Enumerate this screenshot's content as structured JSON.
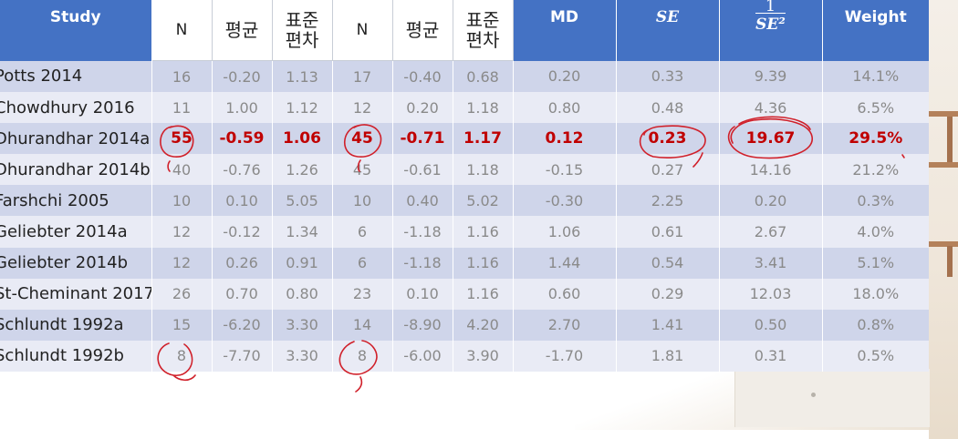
{
  "header": {
    "study": "Study",
    "n1": "N",
    "mean1": "평균",
    "sd1_line1": "표준",
    "sd1_line2": "편차",
    "n2": "N",
    "mean2": "평균",
    "sd2_line1": "표준",
    "sd2_line2": "편차",
    "md": "MD",
    "se": "SE",
    "inv_num": "1",
    "inv_den": "SE²",
    "weight": "Weight"
  },
  "rows": [
    {
      "study": "Potts 2014",
      "n1": "16",
      "m1": "-0.20",
      "sd1": "1.13",
      "n2": "17",
      "m2": "-0.40",
      "sd2": "0.68",
      "md": "0.20",
      "se": "0.33",
      "inv": "9.39",
      "w": "14.1%"
    },
    {
      "study": "Chowdhury 2016",
      "n1": "11",
      "m1": "1.00",
      "sd1": "1.12",
      "n2": "12",
      "m2": "0.20",
      "sd2": "1.18",
      "md": "0.80",
      "se": "0.48",
      "inv": "4.36",
      "w": "6.5%"
    },
    {
      "study": "Dhurandhar 2014a",
      "n1": "55",
      "m1": "-0.59",
      "sd1": "1.06",
      "n2": "45",
      "m2": "-0.71",
      "sd2": "1.17",
      "md": "0.12",
      "se": "0.23",
      "inv": "19.67",
      "w": "29.5%"
    },
    {
      "study": "Dhurandhar 2014b",
      "n1": "40",
      "m1": "-0.76",
      "sd1": "1.26",
      "n2": "45",
      "m2": "-0.61",
      "sd2": "1.18",
      "md": "-0.15",
      "se": "0.27",
      "inv": "14.16",
      "w": "21.2%"
    },
    {
      "study": "Farshchi 2005",
      "n1": "10",
      "m1": "0.10",
      "sd1": "5.05",
      "n2": "10",
      "m2": "0.40",
      "sd2": "5.02",
      "md": "-0.30",
      "se": "2.25",
      "inv": "0.20",
      "w": "0.3%"
    },
    {
      "study": "Geliebter 2014a",
      "n1": "12",
      "m1": "-0.12",
      "sd1": "1.34",
      "n2": "6",
      "m2": "-1.18",
      "sd2": "1.16",
      "md": "1.06",
      "se": "0.61",
      "inv": "2.67",
      "w": "4.0%"
    },
    {
      "study": "Geliebter 2014b",
      "n1": "12",
      "m1": "0.26",
      "sd1": "0.91",
      "n2": "6",
      "m2": "-1.18",
      "sd2": "1.16",
      "md": "1.44",
      "se": "0.54",
      "inv": "3.41",
      "w": "5.1%"
    },
    {
      "study": "St-Cheminant 2017",
      "n1": "26",
      "m1": "0.70",
      "sd1": "0.80",
      "n2": "23",
      "m2": "0.10",
      "sd2": "1.16",
      "md": "0.60",
      "se": "0.29",
      "inv": "12.03",
      "w": "18.0%"
    },
    {
      "study": "Schlundt 1992a",
      "n1": "15",
      "m1": "-6.20",
      "sd1": "3.30",
      "n2": "14",
      "m2": "-8.90",
      "sd2": "4.20",
      "md": "2.70",
      "se": "1.41",
      "inv": "0.50",
      "w": "0.8%"
    },
    {
      "study": "Schlundt 1992b",
      "n1": "8",
      "m1": "-7.70",
      "sd1": "3.30",
      "n2": "8",
      "m2": "-6.00",
      "sd2": "3.90",
      "md": "-1.70",
      "se": "1.81",
      "inv": "0.31",
      "w": "0.5%"
    }
  ],
  "colors": {
    "header_bg": "#4472c4",
    "row_odd": "#cfd5ea",
    "row_even": "#e9ebf5",
    "highlight_text": "#c00000",
    "annotation_ink": "#d0202a"
  }
}
